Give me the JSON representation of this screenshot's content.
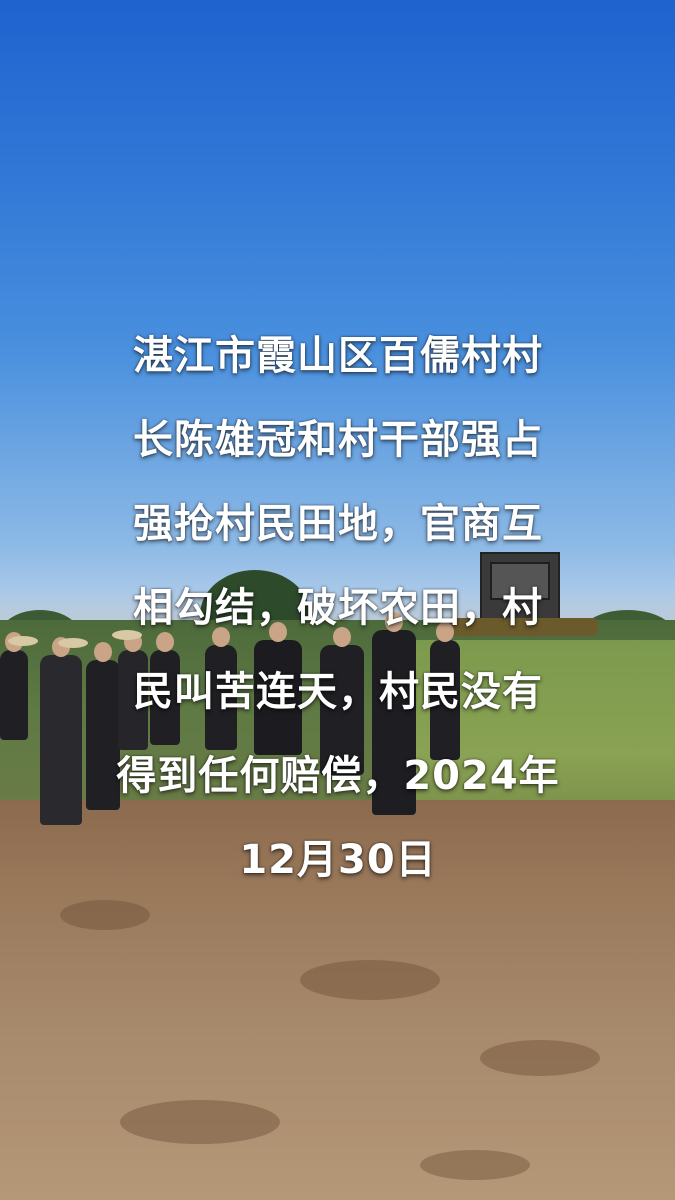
{
  "caption": {
    "lines": [
      "湛江市霞山区百儒村村",
      "长陈雄冠和村干部强占",
      "强抢村民田地，官商互",
      "相勾结，破坏农田，村",
      "民叫苦连天，村民没有",
      "得到任何赔偿，2024年",
      "12月30日"
    ]
  },
  "colors": {
    "sky_top": "#1e63cf",
    "sky_bottom": "#c6d8ea",
    "ground": "#9b7a5c",
    "caption_text": "#ffffff"
  }
}
